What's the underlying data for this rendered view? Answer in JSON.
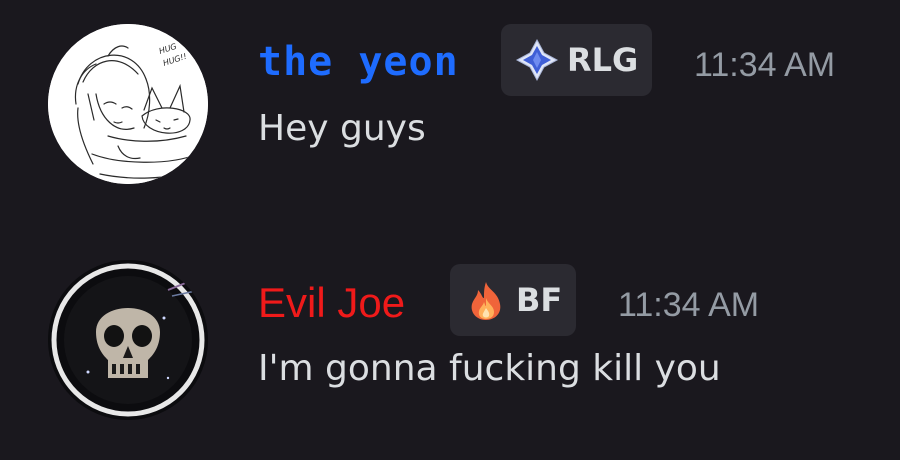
{
  "messages": [
    {
      "username": "the yeon",
      "username_color": "#1e6cff",
      "tag": {
        "label": "RLG",
        "icon": "blue-diamond-icon"
      },
      "timestamp": "11:34 AM",
      "content": "Hey guys",
      "avatar": {
        "icon": "sketch-anime-avatar",
        "doodle_text": "HUG HUG!!"
      }
    },
    {
      "username": "Evil Joe",
      "username_color": "#f01a1a",
      "tag": {
        "label": "BF",
        "icon": "fire-icon"
      },
      "timestamp": "11:34 AM",
      "content": "I'm gonna fucking kill you",
      "avatar": {
        "icon": "skull-avatar"
      }
    }
  ],
  "colors": {
    "background": "#1a181e",
    "tag_background": "#2b2a31",
    "message_text": "#dbdee1",
    "timestamp_text": "#949ba4"
  }
}
